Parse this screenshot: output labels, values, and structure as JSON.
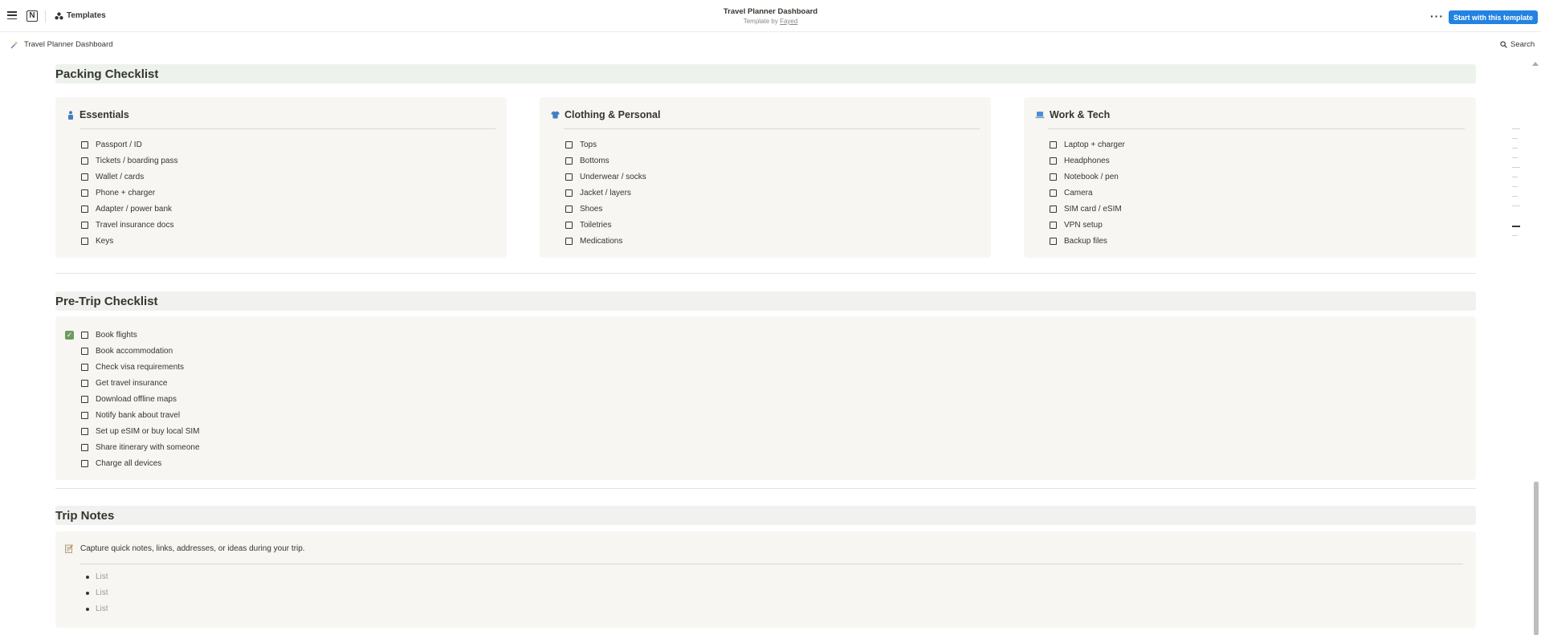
{
  "topbar": {
    "templates_label": "Templates",
    "title": "Travel Planner Dashboard",
    "subtitle_prefix": "Template by ",
    "subtitle_author": "Fayed",
    "more_label": "···",
    "start_button": "Start with this template"
  },
  "breadcrumb": {
    "page": "Travel Planner Dashboard",
    "search_label": "Search"
  },
  "packing": {
    "title": "Packing Checklist",
    "cards": [
      {
        "title": "Essentials",
        "icon": "person-icon",
        "items": [
          "Passport / ID",
          "Tickets / boarding pass",
          "Wallet / cards",
          "Phone + charger",
          "Adapter / power bank",
          "Travel insurance docs",
          "Keys"
        ]
      },
      {
        "title": "Clothing & Personal",
        "icon": "shirt-icon",
        "items": [
          "Tops",
          "Bottoms",
          "Underwear / socks",
          "Jacket / layers",
          "Shoes",
          "Toiletries",
          "Medications"
        ]
      },
      {
        "title": "Work & Tech",
        "icon": "laptop-icon",
        "items": [
          "Laptop + charger",
          "Headphones",
          "Notebook / pen",
          "Camera",
          "SIM card / eSIM",
          "VPN setup",
          "Backup files"
        ]
      }
    ]
  },
  "pretrip": {
    "title": "Pre-Trip Checklist",
    "items": [
      "Book flights",
      "Book accommodation",
      "Check visa requirements",
      "Get travel insurance",
      "Download offline maps",
      "Notify bank about travel",
      "Set up eSIM or buy local SIM",
      "Share itinerary with someone",
      "Charge all devices"
    ]
  },
  "notes": {
    "title": "Trip Notes",
    "callout": "Capture quick notes, links, addresses, or ideas during your trip.",
    "bullets": [
      "List",
      "List",
      "List"
    ]
  },
  "colors": {
    "accent": "#2383e2",
    "packing_header_bg": "#edf3ec",
    "section_header_bg": "#f1f1ef",
    "card_bg": "#f7f6f3",
    "check_green": "#6c9b5e"
  }
}
